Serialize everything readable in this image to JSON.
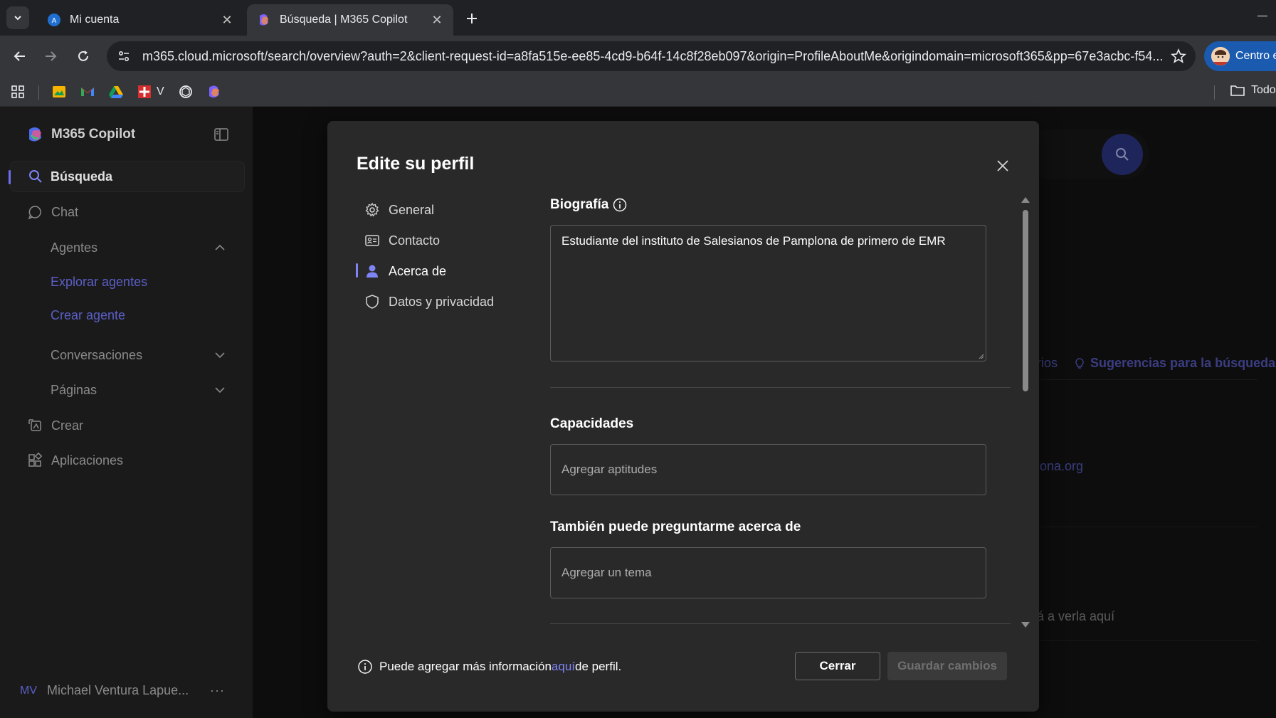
{
  "browser": {
    "tabs": [
      {
        "title": "Mi cuenta",
        "active": false
      },
      {
        "title": "Búsqueda | M365 Copilot",
        "active": true
      }
    ],
    "url": "m365.cloud.microsoft/search/overview?auth=2&client-request-id=a8fa515e-ee85-4cd9-b64f-14c8f28eb097&origin=ProfileAboutMe&origindomain=microsoft365&pp=67e3acbc-f54...",
    "profile_label": "Centro e",
    "bookmarks": {
      "v_label": "V",
      "folder_label": "Todo"
    }
  },
  "sidebar": {
    "brand": "M365 Copilot",
    "search_label": "Búsqueda",
    "chat_label": "Chat",
    "agents_label": "Agentes",
    "explore_agents": "Explorar agentes",
    "create_agent": "Crear agente",
    "conversations": "Conversaciones",
    "pages": "Páginas",
    "create": "Crear",
    "apps": "Aplicaciones",
    "user_initials": "MV",
    "user_name": "Michael Ventura Lapue...",
    "more": "···"
  },
  "background": {
    "rios": "rios",
    "suggestions": "Sugerencias para la búsqueda",
    "lona": "lona.org",
    "verla": "á a verla aquí"
  },
  "modal": {
    "title": "Edite su perfil",
    "nav": [
      {
        "label": "General",
        "icon": "gear-icon"
      },
      {
        "label": "Contacto",
        "icon": "contact-card-icon"
      },
      {
        "label": "Acerca de",
        "icon": "person-icon"
      },
      {
        "label": "Datos y privacidad",
        "icon": "shield-icon"
      }
    ],
    "bio": {
      "title": "Biografía",
      "value": "Estudiante del instituto de Salesianos de Pamplona de primero de EMR"
    },
    "skills": {
      "title": "Capacidades",
      "placeholder": "Agregar aptitudes"
    },
    "ask_me": {
      "title": "También puede preguntarme acerca de",
      "placeholder": "Agregar un tema"
    },
    "footer": {
      "prefix": "Puede agregar más información ",
      "link": "aquí",
      "suffix": "de perfil."
    },
    "close_label": "Cerrar",
    "save_label": "Guardar cambios"
  },
  "colors": {
    "accent": "#5b5fc7",
    "accent_light": "#7f85f5",
    "modal_bg": "#292929"
  }
}
